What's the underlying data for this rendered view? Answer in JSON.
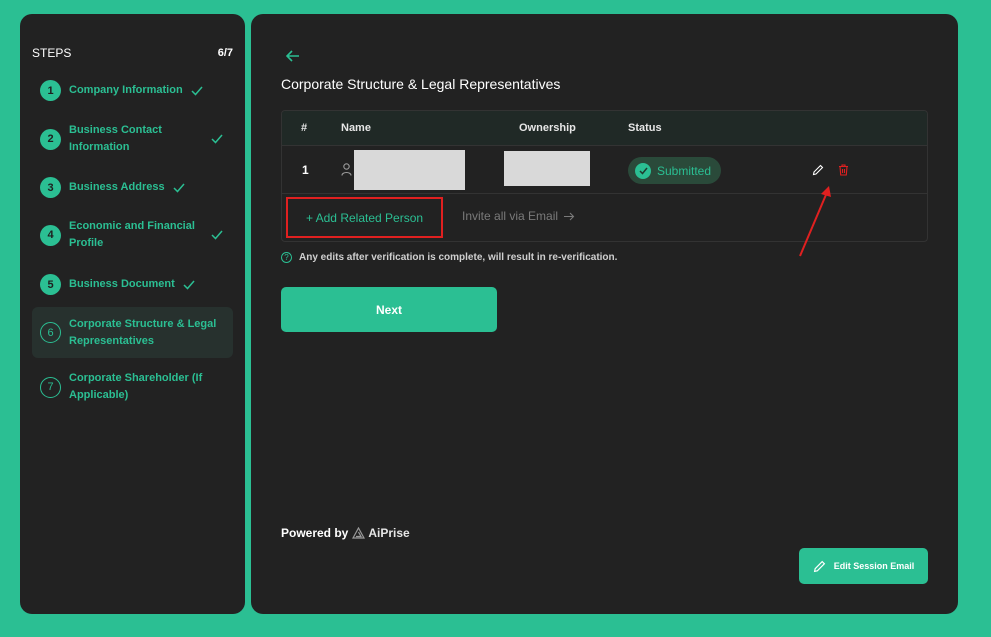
{
  "sidebar": {
    "heading": "STEPS",
    "progress": "6/7",
    "steps": [
      {
        "number": "1",
        "label": "Company Information",
        "done": true
      },
      {
        "number": "2",
        "label": "Business Contact Information",
        "done": true
      },
      {
        "number": "3",
        "label": "Business Address",
        "done": true
      },
      {
        "number": "4",
        "label": "Economic and Financial Profile",
        "done": true
      },
      {
        "number": "5",
        "label": "Business Document",
        "done": true
      },
      {
        "number": "6",
        "label": "Corporate Structure & Legal Representatives",
        "done": false,
        "active": true
      },
      {
        "number": "7",
        "label": "Corporate Shareholder (If Applicable)",
        "done": false
      }
    ]
  },
  "main": {
    "title": "Corporate Structure & Legal Representatives",
    "table": {
      "columns": [
        "#",
        "Name",
        "Ownership",
        "Status"
      ],
      "rows": [
        {
          "index": "1",
          "status": "Submitted"
        }
      ]
    },
    "add_related_label": "+ Add Related Person",
    "invite_label": "Invite all via Email",
    "notice": "Any edits after verification is complete, will result in re-verification.",
    "next_label": "Next",
    "powered_by": "Powered by",
    "brand": "AiPrise",
    "edit_email_label": "Edit Session Email"
  },
  "colors": {
    "accent": "#2bbf93",
    "panel": "#222222",
    "danger": "#e02020"
  }
}
